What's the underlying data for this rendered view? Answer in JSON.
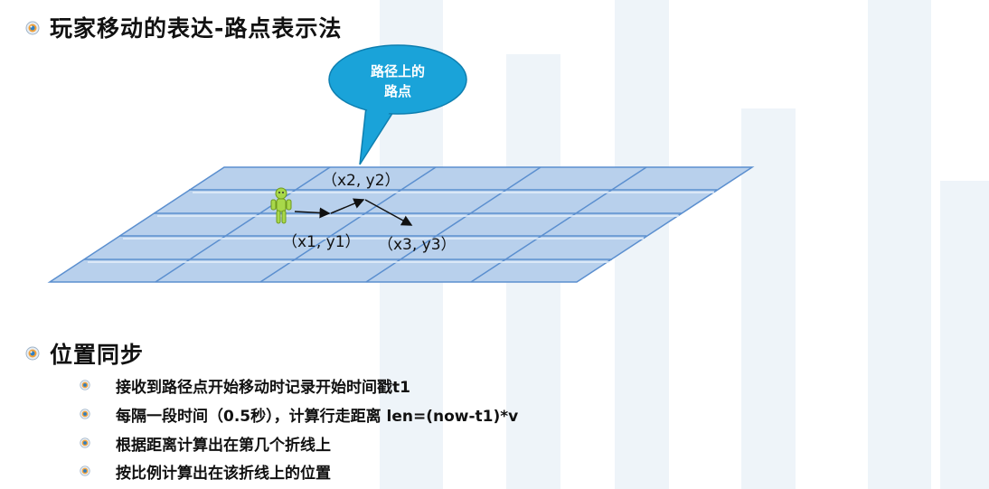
{
  "section1": {
    "title": "玩家移动的表达-路点表示法"
  },
  "callout": {
    "line1": "路径上的",
    "line2": "路点"
  },
  "points": {
    "p1": "（x1, y1）",
    "p2": "（x2, y2）",
    "p3": "（x3, y3）"
  },
  "section2": {
    "title": "位置同步",
    "items": [
      "接收到路径点开始移动时记录开始时间戳t1",
      "每隔一段时间（0.5秒），计算行走距离 len=(now-t1)*v",
      "根据距离计算出在第几个折线上",
      "按比例计算出在该折线上的位置"
    ]
  },
  "colors": {
    "grid_fill": "#b8d0ec",
    "grid_line": "#5b8fcf",
    "callout_fill": "#1aa3d9",
    "character": "#9acd32"
  }
}
